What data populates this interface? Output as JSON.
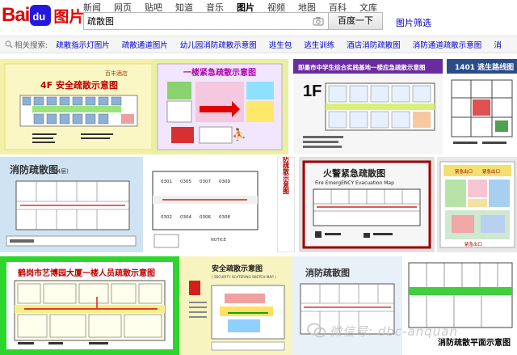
{
  "header": {
    "logo_left": "Bai",
    "logo_paw": "du",
    "logo_right": "图片",
    "nav": [
      "新闻",
      "网页",
      "贴吧",
      "知道",
      "音乐",
      "图片",
      "视频",
      "地图",
      "百科",
      "文库"
    ],
    "active_nav": "图片",
    "search_value": "疏散图",
    "search_button": "百度一下",
    "filter_link": "图片筛选"
  },
  "related": {
    "label": "相关搜索:",
    "links": [
      "疏散指示灯图片",
      "疏散通道图片",
      "幼儿园消防疏散示意图",
      "逃生包",
      "逃生训练",
      "酒店消防疏散图",
      "消防通道疏散示意图",
      "消"
    ]
  },
  "tiles": {
    "t1": {
      "title": "4F 安全疏散示意图",
      "hotel": "百丰酒店"
    },
    "t2": {
      "title": "一楼紧急疏散示意图"
    },
    "t3": {
      "title": "即墨市中学生综合实践基地一楼应急疏散示意图",
      "floor": "1F"
    },
    "t4": {
      "title": "1401 逃生路线图"
    },
    "t5": {
      "title": "消防疏散图",
      "sub": "(4层)"
    },
    "t6": {
      "side": "消防疏散示意图",
      "rooms": [
        "0301",
        "0305",
        "0307",
        "0309",
        "0302",
        "0304",
        "0306",
        "0308"
      ],
      "note": "NOTICE"
    },
    "t7": {
      "title": "火警紧急疏散图",
      "subtitle": "Fire EmergENCY Evacuation Map"
    },
    "t8": {
      "labels": [
        "紧急出口",
        "紧急出口",
        "紧急出口"
      ]
    },
    "t9": {
      "title": "鹤岗市艺博园大厦一楼人员疏散示意图"
    },
    "t10": {
      "title": "安全疏散示意图",
      "subtitle": "( SECURITY SCATERING SKETCH MAP )"
    },
    "t11": {
      "title": "消防疏散图"
    },
    "t12": {
      "title": "消防疏散平面示意图"
    }
  },
  "watermark": {
    "text": "微信号: dbc-anquan"
  }
}
